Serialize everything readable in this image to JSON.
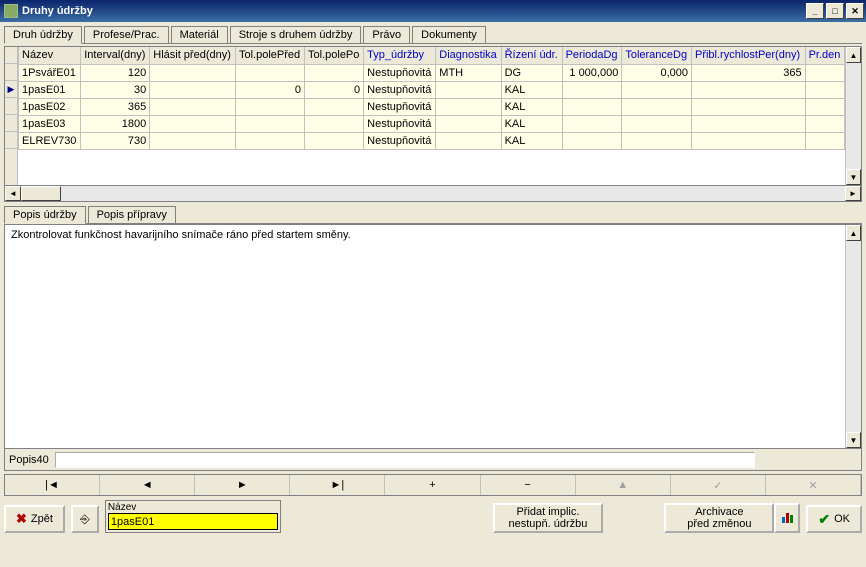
{
  "window": {
    "title": "Druhy údržby"
  },
  "tabs_main": [
    {
      "label": "Druh údržby",
      "active": true
    },
    {
      "label": "Profese/Prac."
    },
    {
      "label": "Materiál"
    },
    {
      "label": "Stroje s druhem údržby"
    },
    {
      "label": "Právo"
    },
    {
      "label": "Dokumenty"
    }
  ],
  "grid": {
    "columns": [
      {
        "label": "Název"
      },
      {
        "label": "Interval(dny)"
      },
      {
        "label": "Hlásit před(dny)"
      },
      {
        "label": "Tol.polePřed"
      },
      {
        "label": "Tol.polePo"
      },
      {
        "label": "Typ_údržby",
        "link": true
      },
      {
        "label": "Diagnostika",
        "link": true
      },
      {
        "label": "Řízení údr.",
        "link": true
      },
      {
        "label": "PeriodaDg",
        "link": true
      },
      {
        "label": "ToleranceDg",
        "link": true
      },
      {
        "label": "Přibl.rychlostPer(dny)",
        "link": true
      },
      {
        "label": "Pr.den",
        "link": true
      }
    ],
    "rows": [
      {
        "nazev": "1PsvářE01",
        "interval": "120",
        "hlasit": "",
        "tpre": "",
        "tpo": "",
        "typ": "Nestupňovitá",
        "diag": "MTH",
        "riz": "DG",
        "perdg": "1 000,000",
        "toldg": "0,000",
        "rychl": "365",
        "prden": ""
      },
      {
        "nazev": "1pasE01",
        "interval": "30",
        "hlasit": "",
        "tpre": "0",
        "tpo": "0",
        "typ": "Nestupňovitá",
        "diag": "",
        "riz": "KAL",
        "perdg": "",
        "toldg": "",
        "rychl": "",
        "prden": "",
        "current": true
      },
      {
        "nazev": "1pasE02",
        "interval": "365",
        "hlasit": "",
        "tpre": "",
        "tpo": "",
        "typ": "Nestupňovitá",
        "diag": "",
        "riz": "KAL",
        "perdg": "",
        "toldg": "",
        "rychl": "",
        "prden": ""
      },
      {
        "nazev": "1pasE03",
        "interval": "1800",
        "hlasit": "",
        "tpre": "",
        "tpo": "",
        "typ": "Nestupňovitá",
        "diag": "",
        "riz": "KAL",
        "perdg": "",
        "toldg": "",
        "rychl": "",
        "prden": ""
      },
      {
        "nazev": "ELREV730",
        "interval": "730",
        "hlasit": "",
        "tpre": "",
        "tpo": "",
        "typ": "Nestupňovitá",
        "diag": "",
        "riz": "KAL",
        "perdg": "",
        "toldg": "",
        "rychl": "",
        "prden": ""
      }
    ]
  },
  "tabs_desc": [
    {
      "label": "Popis údržby",
      "active": true
    },
    {
      "label": "Popis přípravy"
    }
  ],
  "desc_text": "Zkontrolovat funkčnost havarijního snímače ráno před startem směny.",
  "popis40_label": "Popis40",
  "nav": {
    "first": "|◄",
    "prev": "◄",
    "next": "►",
    "last": "►|",
    "add": "+",
    "del": "−",
    "edit": "▲",
    "ok": "✓",
    "cancel": "✕"
  },
  "bottom": {
    "back": "Zpět",
    "name_label": "Název",
    "name_value": "1pasE01",
    "add_implicit": {
      "l1": "Přidat implic.",
      "l2": "nestupň. údržbu"
    },
    "archive": {
      "l1": "Archivace",
      "l2": "před změnou"
    },
    "ok": "OK"
  }
}
